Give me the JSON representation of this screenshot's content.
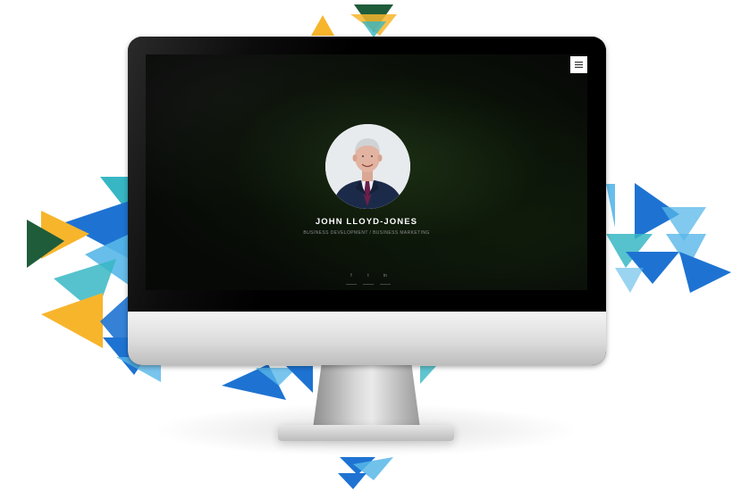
{
  "profile": {
    "name": "JOHN LLOYD-JONES",
    "subtitle": "BUSINESS DEVELOPMENT / BUSINESS MARKETING"
  },
  "social": [
    {
      "icon": "facebook-icon",
      "glyph": "f"
    },
    {
      "icon": "twitter-icon",
      "glyph": "t"
    },
    {
      "icon": "linkedin-icon",
      "glyph": "in"
    }
  ],
  "menu": {
    "icon": "hamburger-menu-icon"
  },
  "colors": {
    "yellow": "#F7B52C",
    "dark_green": "#1F5C3A",
    "blue": "#1E73D2",
    "light_blue": "#57B7E8",
    "teal": "#37B7C4"
  }
}
